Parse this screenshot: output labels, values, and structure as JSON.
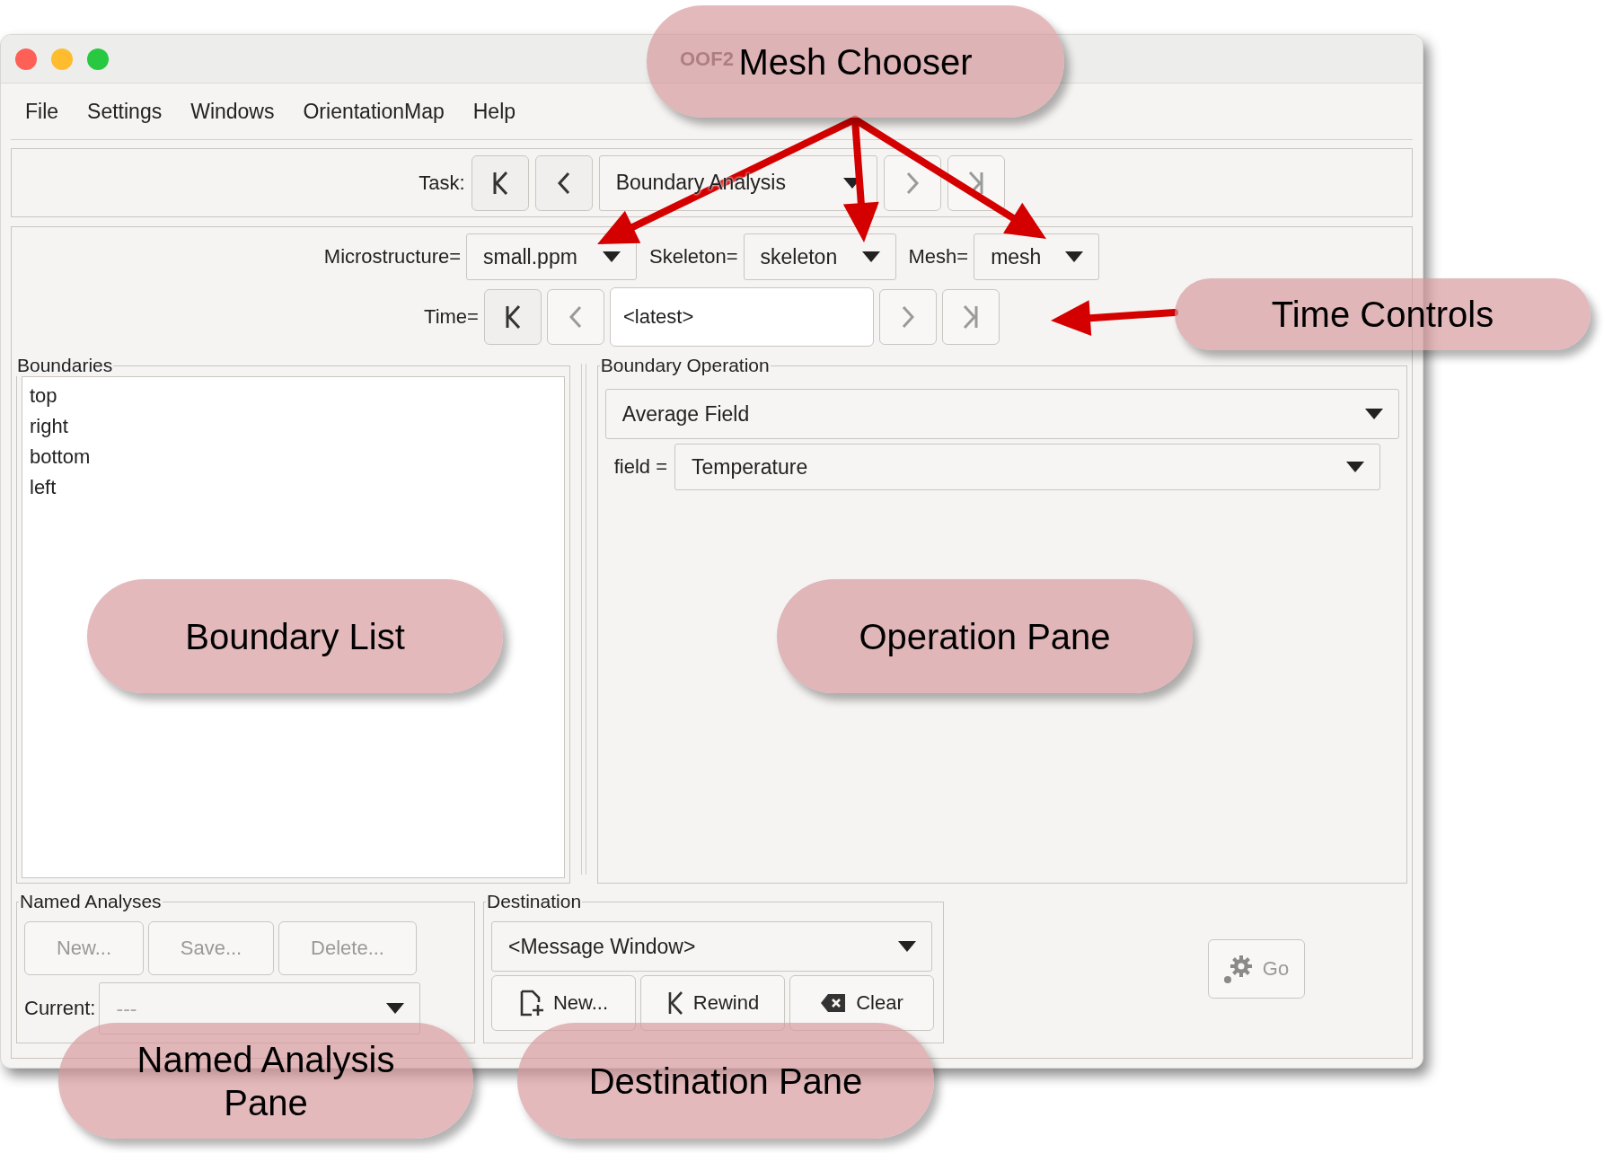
{
  "window": {
    "title": "OOF2"
  },
  "menu": [
    {
      "label": "File"
    },
    {
      "label": "Settings"
    },
    {
      "label": "Windows"
    },
    {
      "label": "OrientationMap"
    },
    {
      "label": "Help"
    }
  ],
  "task": {
    "label": "Task:",
    "value": "Boundary Analysis",
    "nav": [
      {
        "kind": "first",
        "disabled": false
      },
      {
        "kind": "prev",
        "disabled": false
      },
      {
        "kind": "next",
        "disabled": true
      },
      {
        "kind": "last",
        "disabled": true
      }
    ]
  },
  "choosers": [
    {
      "label": "Microstructure=",
      "value": "small.ppm"
    },
    {
      "label": "Skeleton=",
      "value": "skeleton"
    },
    {
      "label": "Mesh=",
      "value": "mesh"
    }
  ],
  "time": {
    "label": "Time=",
    "value": "<latest>",
    "nav": [
      {
        "kind": "first",
        "disabled": false
      },
      {
        "kind": "prev",
        "disabled": true
      },
      {
        "kind": "next",
        "disabled": true
      },
      {
        "kind": "last",
        "disabled": true
      }
    ]
  },
  "boundaries": {
    "title": "Boundaries",
    "items": [
      {
        "label": "top",
        "selected": false
      },
      {
        "label": "right",
        "selected": false
      },
      {
        "label": "bottom",
        "selected": false
      },
      {
        "label": "left",
        "selected": false
      }
    ]
  },
  "boundary_operation": {
    "title": "Boundary Operation",
    "operation": "Average Field",
    "parameters": [
      {
        "label": "field =",
        "value": "Temperature"
      }
    ]
  },
  "named_analyses": {
    "title": "Named Analyses",
    "buttons": [
      {
        "label": "New...",
        "disabled": true
      },
      {
        "label": "Save...",
        "disabled": true
      },
      {
        "label": "Delete...",
        "disabled": true
      }
    ],
    "current": {
      "label": "Current:",
      "value": "---",
      "disabled": true
    }
  },
  "destination": {
    "title": "Destination",
    "value": "<Message Window>",
    "buttons": [
      {
        "kind": "new",
        "label": "New..."
      },
      {
        "kind": "rewind",
        "label": "Rewind"
      },
      {
        "kind": "clear",
        "label": "Clear"
      }
    ]
  },
  "go_button": {
    "label": "Go",
    "disabled": true
  },
  "annotations": [
    {
      "text": "Mesh Chooser"
    },
    {
      "text": "Time Controls"
    },
    {
      "text": "Boundary List"
    },
    {
      "text": "Operation Pane"
    },
    {
      "text": "Named Analysis Pane"
    },
    {
      "text": "Destination Pane"
    }
  ]
}
